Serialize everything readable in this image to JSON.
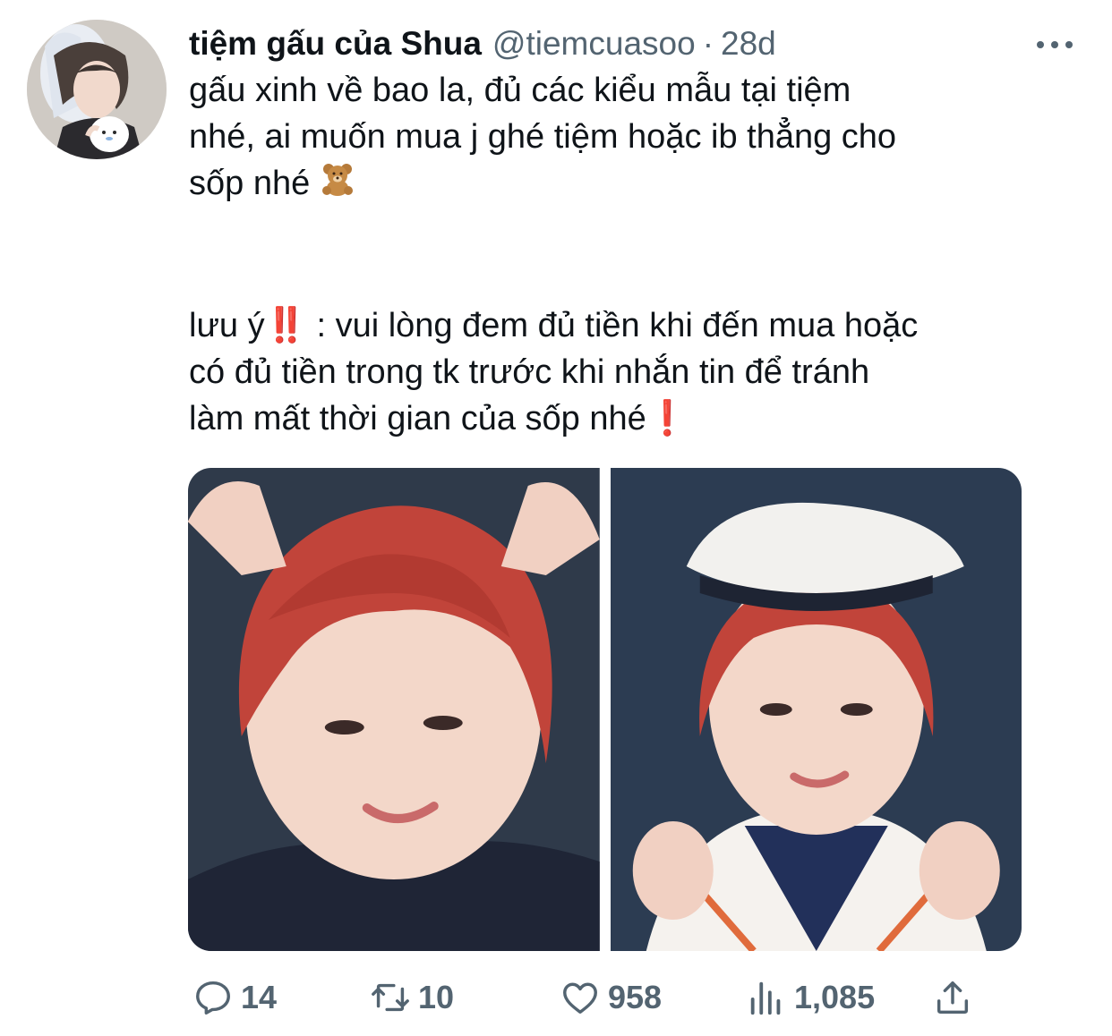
{
  "tweet": {
    "display_name": "tiệm gấu của Shua",
    "handle": "@tiemcuasoo",
    "separator": "·",
    "time": "28d",
    "line1": "gấu xinh về bao la, đủ các kiểu mẫu tại tiệm",
    "line2": "nhé, ai muốn mua j ghé tiệm hoặc ib thẳng cho",
    "line3": "sốp nhé",
    "note_prefix": "lưu ý",
    "note_marks": "‼️",
    "note_rest": " : vui lòng đem đủ tiền khi đến mua hoặc",
    "line5": "có đủ tiền trong tk trước khi nhắn tin để tránh",
    "line6": "làm mất thời gian của sốp nhé",
    "end_mark": "❗"
  },
  "icons": {
    "avatar": "profile-photo",
    "more": "more-icon",
    "emoji": "teddy-bear-icon",
    "reply": "reply-icon",
    "retweet": "retweet-icon",
    "like": "heart-icon",
    "views": "analytics-icon",
    "share": "share-icon"
  },
  "stats": {
    "replies": "14",
    "retweets": "10",
    "likes": "958",
    "views": "1,085"
  },
  "colors": {
    "text": "#0f1419",
    "muted": "#536471",
    "accent_red": "#e0245e",
    "hair": "#c1443a"
  }
}
